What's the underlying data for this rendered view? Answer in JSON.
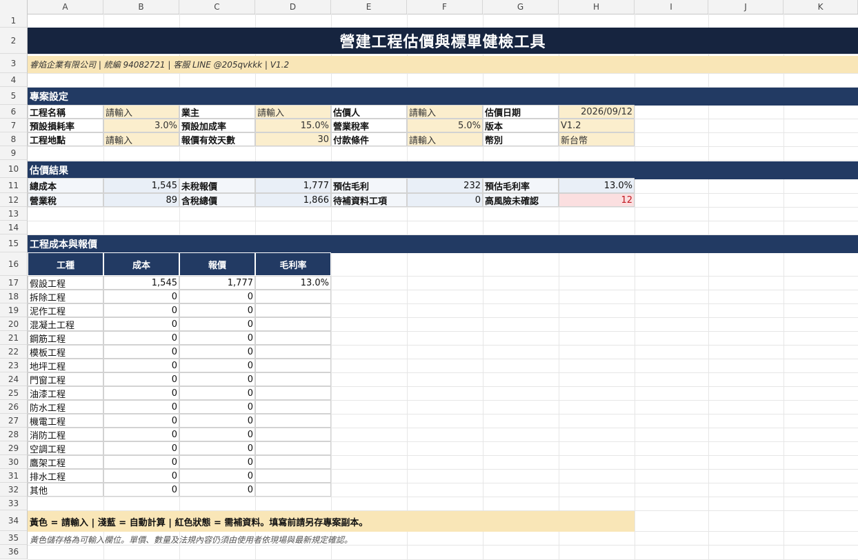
{
  "columns": [
    "A",
    "B",
    "C",
    "D",
    "E",
    "F",
    "G",
    "H",
    "I",
    "J",
    "K"
  ],
  "rows": [
    "1",
    "2",
    "3",
    "4",
    "5",
    "6",
    "7",
    "8",
    "9",
    "10",
    "11",
    "12",
    "13",
    "14",
    "15",
    "16",
    "17",
    "18",
    "19",
    "20",
    "21",
    "22",
    "23",
    "24",
    "25",
    "26",
    "27",
    "28",
    "29",
    "30",
    "31",
    "32",
    "33",
    "34",
    "35",
    "36"
  ],
  "title": "營建工程估價與標單健檢工具",
  "subtitle": "睿焰企業有限公司 | 統編 94082721 | 客服 LINE @205qvkkk | V1.2",
  "sections": {
    "project": "專案設定",
    "results": "估價結果",
    "costs": "工程成本與報價"
  },
  "project": [
    [
      {
        "label": "工程名稱",
        "value": "請輸入",
        "align": "l"
      },
      {
        "label": "業主",
        "value": "請輸入",
        "align": "l"
      },
      {
        "label": "估價人",
        "value": "請輸入",
        "align": "l"
      },
      {
        "label": "估價日期",
        "value": "2026/09/12",
        "align": "r"
      }
    ],
    [
      {
        "label": "預設損耗率",
        "value": "3.0%",
        "align": "r"
      },
      {
        "label": "預設加成率",
        "value": "15.0%",
        "align": "r"
      },
      {
        "label": "營業稅率",
        "value": "5.0%",
        "align": "r"
      },
      {
        "label": "版本",
        "value": "V1.2",
        "align": "l"
      }
    ],
    [
      {
        "label": "工程地點",
        "value": "請輸入",
        "align": "l"
      },
      {
        "label": "報價有效天數",
        "value": "30",
        "align": "r"
      },
      {
        "label": "付款條件",
        "value": "請輸入",
        "align": "l"
      },
      {
        "label": "幣別",
        "value": "新台幣",
        "align": "l"
      }
    ]
  ],
  "results": [
    [
      {
        "label": "總成本",
        "value": "1,545"
      },
      {
        "label": "未稅報價",
        "value": "1,777"
      },
      {
        "label": "預估毛利",
        "value": "232"
      },
      {
        "label": "預估毛利率",
        "value": "13.0%"
      }
    ],
    [
      {
        "label": "營業稅",
        "value": "89"
      },
      {
        "label": "含稅總價",
        "value": "1,866"
      },
      {
        "label": "待補資料工項",
        "value": "0"
      },
      {
        "label": "高風險未確認",
        "value": "12",
        "risk": true
      }
    ]
  ],
  "table": {
    "headers": [
      "工種",
      "成本",
      "報價",
      "毛利率"
    ],
    "rows": [
      [
        "假設工程",
        "1,545",
        "1,777",
        "13.0%"
      ],
      [
        "拆除工程",
        "0",
        "0",
        ""
      ],
      [
        "泥作工程",
        "0",
        "0",
        ""
      ],
      [
        "混凝土工程",
        "0",
        "0",
        ""
      ],
      [
        "鋼筋工程",
        "0",
        "0",
        ""
      ],
      [
        "模板工程",
        "0",
        "0",
        ""
      ],
      [
        "地坪工程",
        "0",
        "0",
        ""
      ],
      [
        "門窗工程",
        "0",
        "0",
        ""
      ],
      [
        "油漆工程",
        "0",
        "0",
        ""
      ],
      [
        "防水工程",
        "0",
        "0",
        ""
      ],
      [
        "機電工程",
        "0",
        "0",
        ""
      ],
      [
        "消防工程",
        "0",
        "0",
        ""
      ],
      [
        "空調工程",
        "0",
        "0",
        ""
      ],
      [
        "鷹架工程",
        "0",
        "0",
        ""
      ],
      [
        "排水工程",
        "0",
        "0",
        ""
      ],
      [
        "其他",
        "0",
        "0",
        ""
      ]
    ]
  },
  "legend": "黃色 = 請輸入 | 淺藍 = 自動計算 | 紅色狀態 = 需補資料。填寫前請另存專案副本。",
  "footnote": "黃色儲存格為可輸入欄位。單價、數量及法規內容仍須由使用者依現場與最新規定確認。"
}
